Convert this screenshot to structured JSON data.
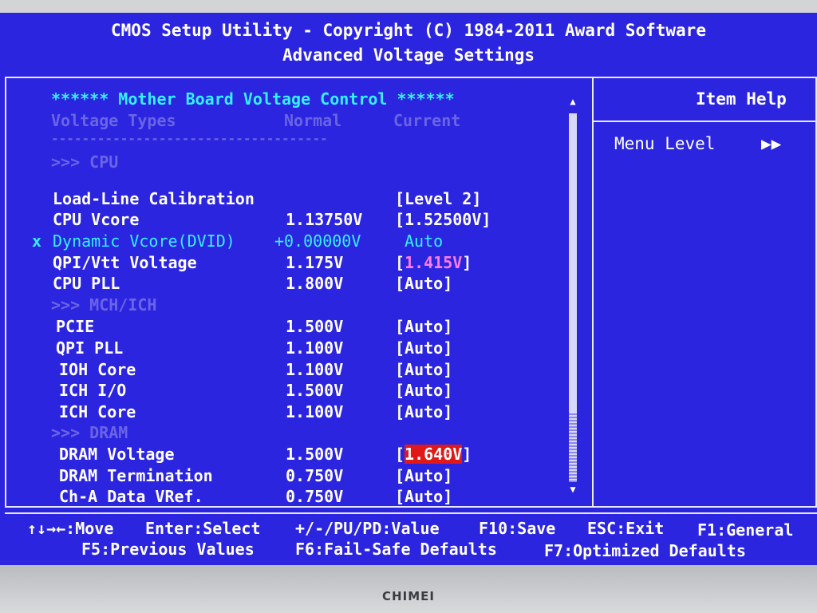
{
  "header": {
    "title": "CMOS Setup Utility - Copyright (C) 1984-2011 Award Software",
    "subtitle": "Advanced Voltage Settings"
  },
  "section_title": "****** Mother Board Voltage Control ******",
  "columns": {
    "types": "Voltage Types",
    "normal": "Normal",
    "current": "Current"
  },
  "separator": "------------------------------------",
  "groups": {
    "cpu": ">>> CPU",
    "mch": ">>> MCH/ICH",
    "dram": ">>> DRAM"
  },
  "items": [
    {
      "label": "Load-Line Calibration",
      "normal": "",
      "current": "[Level 2]"
    },
    {
      "label": "CPU Vcore",
      "normal": "1.13750V",
      "current": "[1.52500V]"
    },
    {
      "prefix": "x",
      "label": "Dynamic Vcore(DVID)",
      "normal": "+0.00000V",
      "current": "Auto"
    },
    {
      "label": "QPI/Vtt Voltage",
      "normal": "1.175V",
      "current_open": "[",
      "current_value": "1.415V",
      "current_close": "]"
    },
    {
      "label": "CPU PLL",
      "normal": "1.800V",
      "current": "[Auto]"
    },
    {
      "label": "PCIE",
      "normal": "1.500V",
      "current": "[Auto]"
    },
    {
      "label": "QPI PLL",
      "normal": "1.100V",
      "current": "[Auto]"
    },
    {
      "label": "IOH Core",
      "normal": "1.100V",
      "current": "[Auto]"
    },
    {
      "label": "ICH I/O",
      "normal": "1.500V",
      "current": "[Auto]"
    },
    {
      "label": "ICH Core",
      "normal": "1.100V",
      "current": "[Auto]"
    },
    {
      "label": "DRAM Voltage",
      "normal": "1.500V",
      "current_open": "[",
      "current_value": "1.640V",
      "current_close": "]"
    },
    {
      "label": "DRAM Termination",
      "normal": "0.750V",
      "current": "[Auto]"
    },
    {
      "label": "Ch-A Data VRef.",
      "normal": "0.750V",
      "current": "[Auto]"
    }
  ],
  "help": {
    "title": "Item Help",
    "menu_level": "Menu Level",
    "menu_level_arrow": "▶▶"
  },
  "scrollbar": {
    "up": "▲",
    "down": "▼"
  },
  "footer": {
    "move": "↑↓→←:Move",
    "select": "Enter:Select",
    "value": "+/-/PU/PD:Value",
    "save": "F10:Save",
    "exit": "ESC:Exit",
    "general": "F1:General",
    "previous": "F5:Previous Values",
    "failsafe": "F6:Fail-Safe Defaults",
    "optimized": "F7:Optimized Defaults"
  },
  "monitor": {
    "brand": "CHIMEI"
  },
  "colors": {
    "background": "#2b25e0",
    "highlight_cyan": "#33f2ff",
    "disabled": "#6a64e6",
    "pink_value": "#ff7bf0",
    "red_value": "#e01818"
  }
}
